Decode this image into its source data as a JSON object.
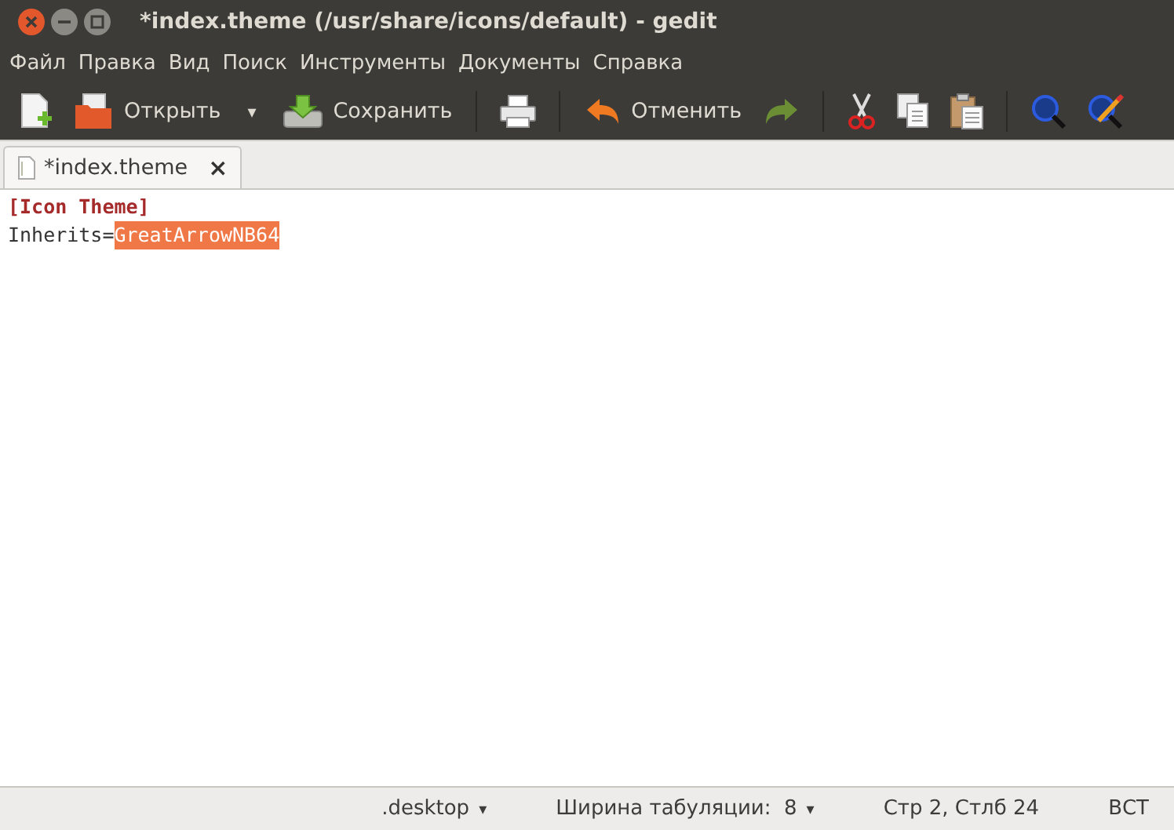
{
  "window": {
    "title": "*index.theme (/usr/share/icons/default) - gedit"
  },
  "menu": [
    "Файл",
    "Правка",
    "Вид",
    "Поиск",
    "Инструменты",
    "Документы",
    "Справка"
  ],
  "toolbar": [
    {
      "kind": "new"
    },
    {
      "kind": "open",
      "label": "Открыть"
    },
    {
      "kind": "dropdown",
      "label": "▾"
    },
    {
      "kind": "save",
      "label": "Сохранить"
    },
    {
      "kind": "separator"
    },
    {
      "kind": "print"
    },
    {
      "kind": "separator"
    },
    {
      "kind": "undo",
      "label": "Отменить"
    },
    {
      "kind": "redo"
    },
    {
      "kind": "separator"
    },
    {
      "kind": "cut"
    },
    {
      "kind": "copy"
    },
    {
      "kind": "paste"
    },
    {
      "kind": "separator"
    },
    {
      "kind": "find"
    },
    {
      "kind": "replace"
    }
  ],
  "tabs": [
    {
      "label": "*index.theme",
      "close": "×",
      "selected": true
    }
  ],
  "editor": {
    "lines": [
      {
        "segments": [
          {
            "kind": "section",
            "text": "[Icon Theme]"
          }
        ]
      },
      {
        "segments": [
          {
            "kind": "plain",
            "text": "Inherits="
          },
          {
            "kind": "selection",
            "text": "GreatArrowNB64"
          }
        ]
      }
    ]
  },
  "status_bar": [
    {
      "text": ".desktop",
      "caret": "▾"
    },
    {
      "text": "Ширина табуляции:  8",
      "caret": "▾"
    },
    {
      "text": "Стр 2, Стлб 24"
    },
    {
      "text": "ВСТ"
    }
  ]
}
